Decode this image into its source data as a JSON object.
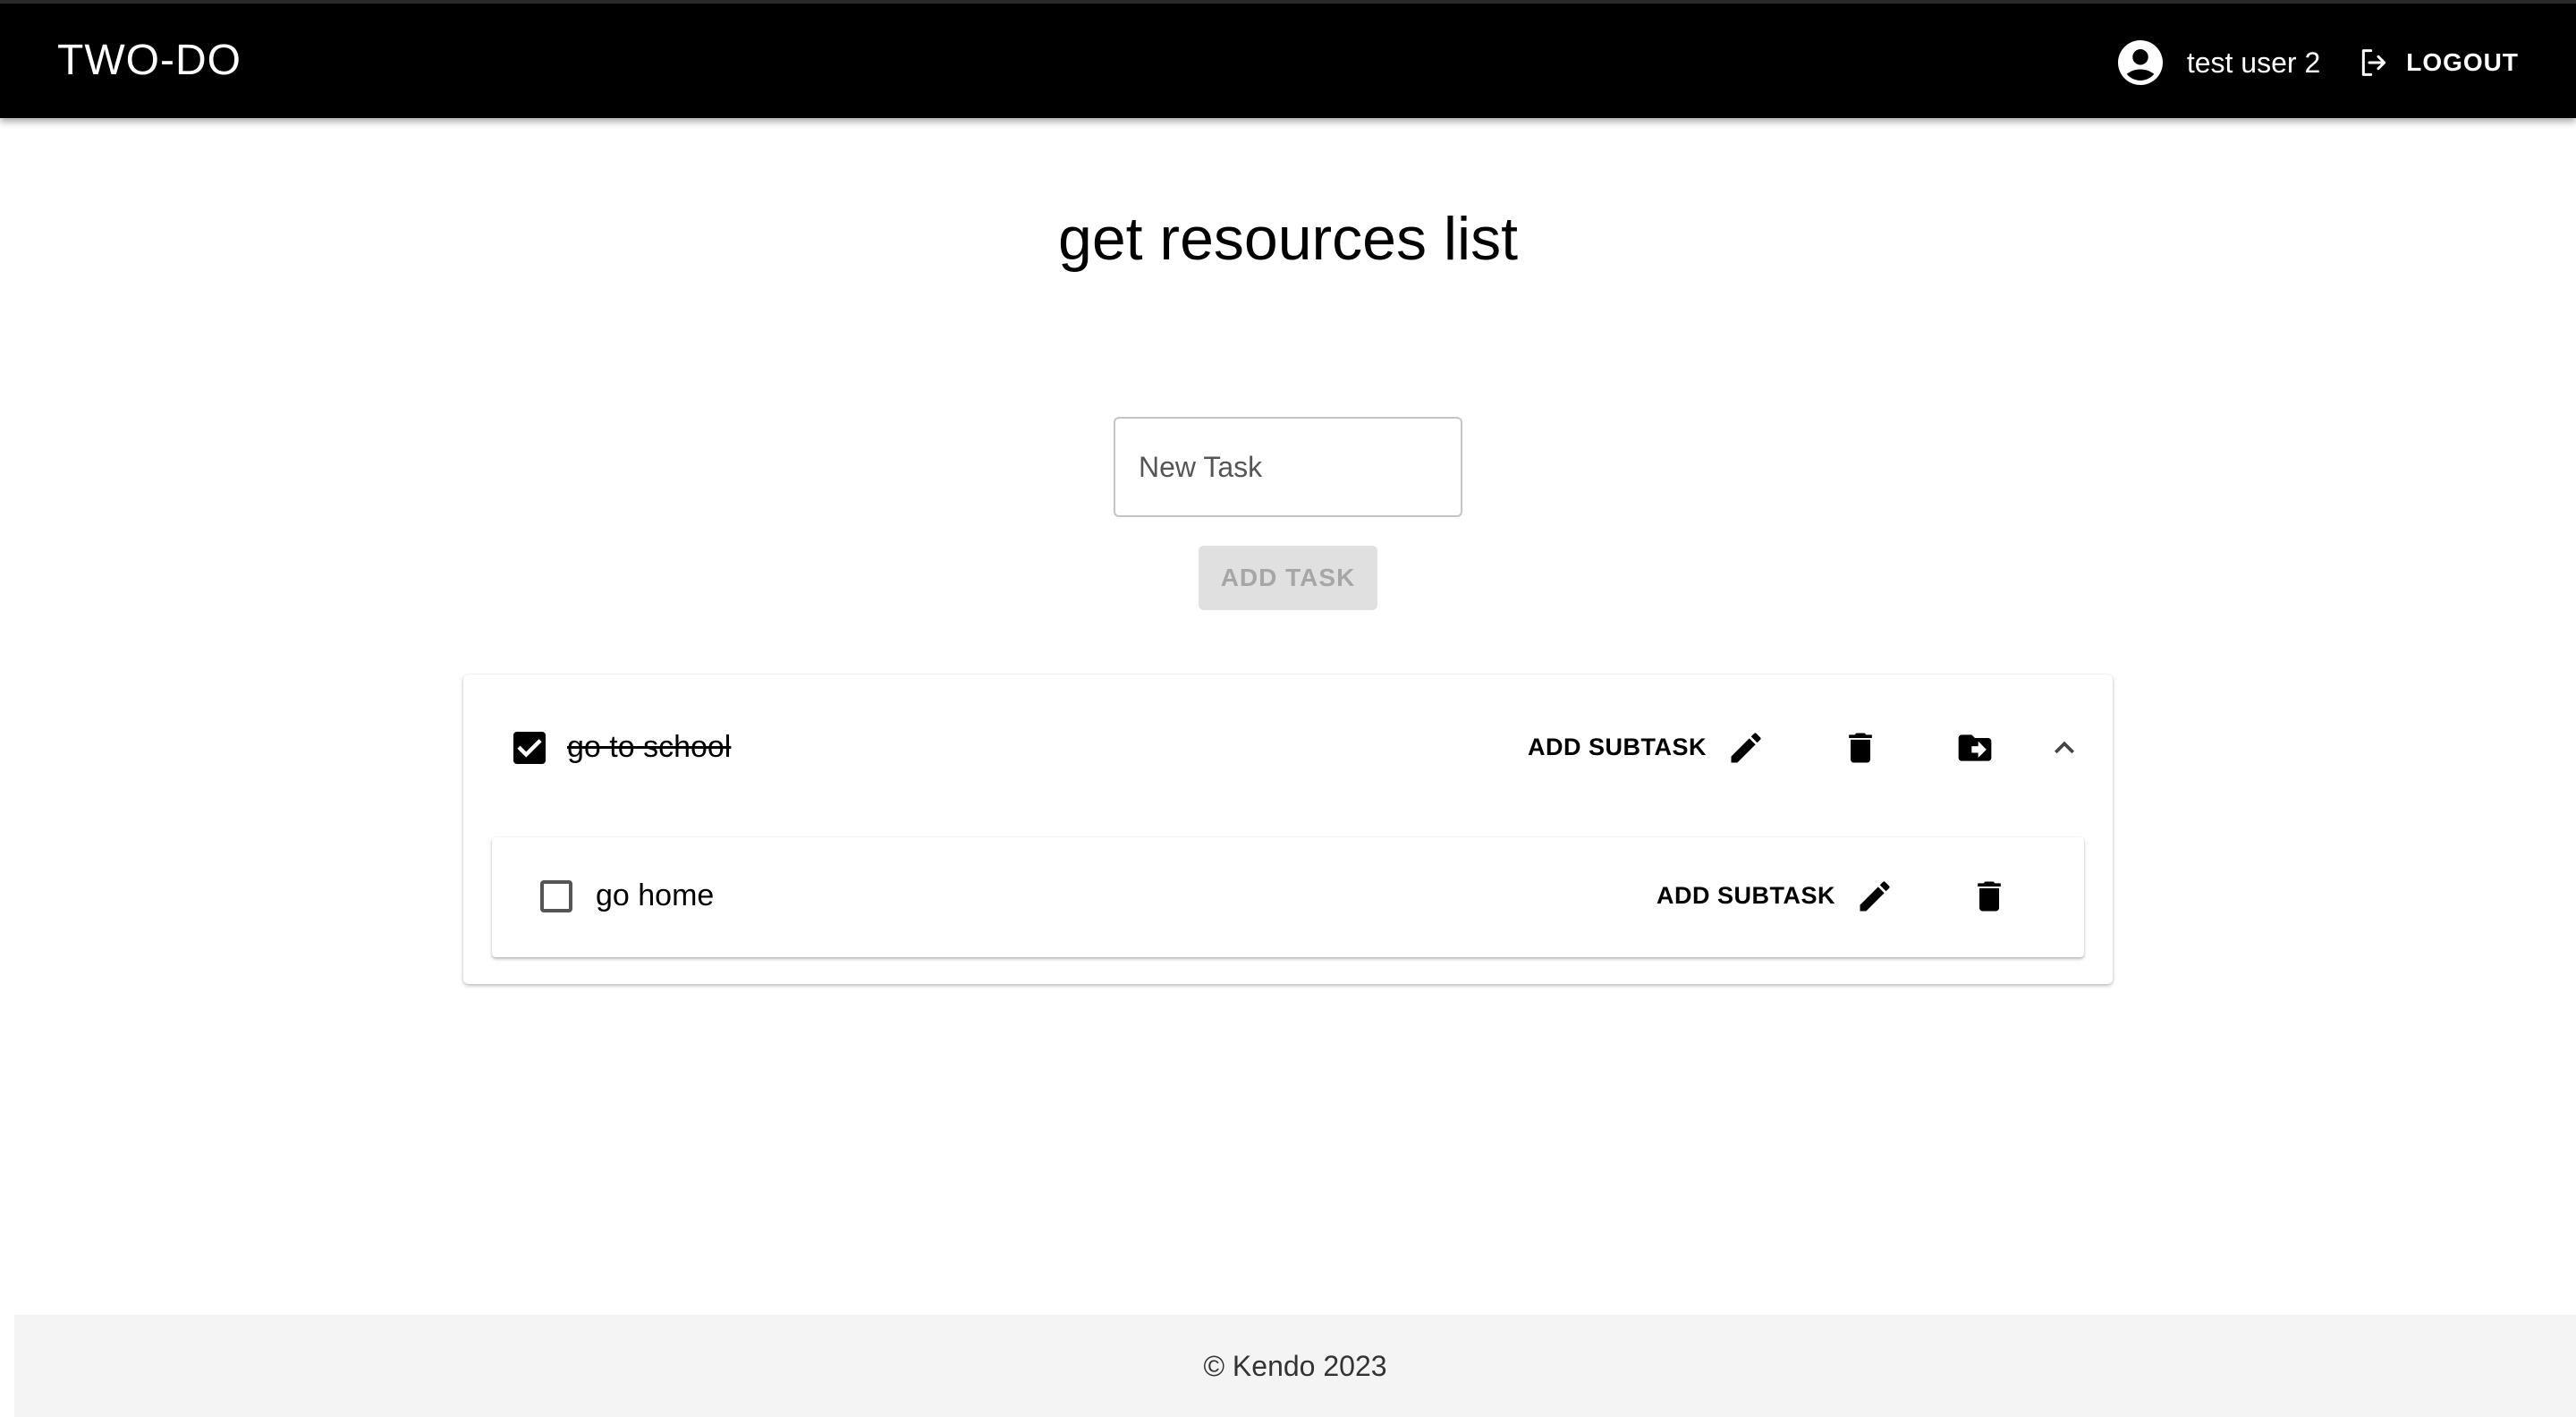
{
  "app": {
    "brand": "TWO-DO",
    "user_name": "test user 2",
    "logout_label": "LOGOUT",
    "icons": {
      "avatar": "account-circle-icon",
      "logout": "logout-icon"
    }
  },
  "main": {
    "list_title": "get resources list",
    "new_task": {
      "value": "",
      "placeholder": "New Task"
    },
    "add_task_label": "ADD TASK",
    "add_task_enabled": false
  },
  "tasks": [
    {
      "label": "go to school",
      "completed": true,
      "add_subtask_label": "ADD SUBTASK",
      "actions": [
        "edit-icon",
        "delete-icon",
        "move-to-folder-icon",
        "chevron-up-icon"
      ],
      "expanded": true,
      "subtasks": [
        {
          "label": "go home",
          "completed": false,
          "add_subtask_label": "ADD SUBTASK",
          "actions": [
            "edit-icon",
            "delete-icon"
          ]
        }
      ]
    }
  ],
  "footer": {
    "text": "© Kendo 2023"
  },
  "colors": {
    "appbar_bg": "#000000",
    "appbar_text": "#ffffff",
    "disabled_button_bg": "#e0e0e0",
    "disabled_button_text": "#a6a6a6",
    "footer_bg": "#f4f4f4"
  }
}
